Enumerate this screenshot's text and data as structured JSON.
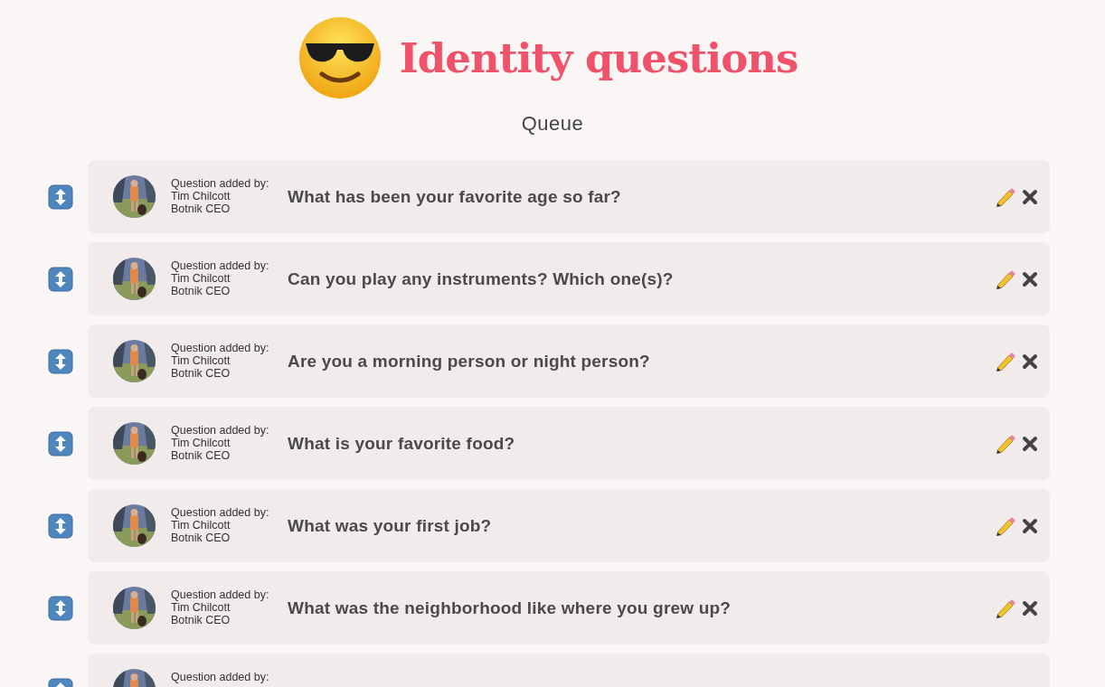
{
  "header": {
    "title": "Identity questions",
    "subtitle": "Queue"
  },
  "questions": [
    {
      "added_by_label": "Question added by:",
      "author": "Tim Chilcott",
      "role": "Botnik CEO",
      "text": "What has been your favorite age so far?"
    },
    {
      "added_by_label": "Question added by:",
      "author": "Tim Chilcott",
      "role": "Botnik CEO",
      "text": "Can you play any instruments? Which one(s)?"
    },
    {
      "added_by_label": "Question added by:",
      "author": "Tim Chilcott",
      "role": "Botnik CEO",
      "text": "Are you a morning person or night person?"
    },
    {
      "added_by_label": "Question added by:",
      "author": "Tim Chilcott",
      "role": "Botnik CEO",
      "text": "What is your favorite food?"
    },
    {
      "added_by_label": "Question added by:",
      "author": "Tim Chilcott",
      "role": "Botnik CEO",
      "text": "What was your first job?"
    },
    {
      "added_by_label": "Question added by:",
      "author": "Tim Chilcott",
      "role": "Botnik CEO",
      "text": "What was the neighborhood like where you grew up?"
    },
    {
      "added_by_label": "Question added by:"
    }
  ]
}
